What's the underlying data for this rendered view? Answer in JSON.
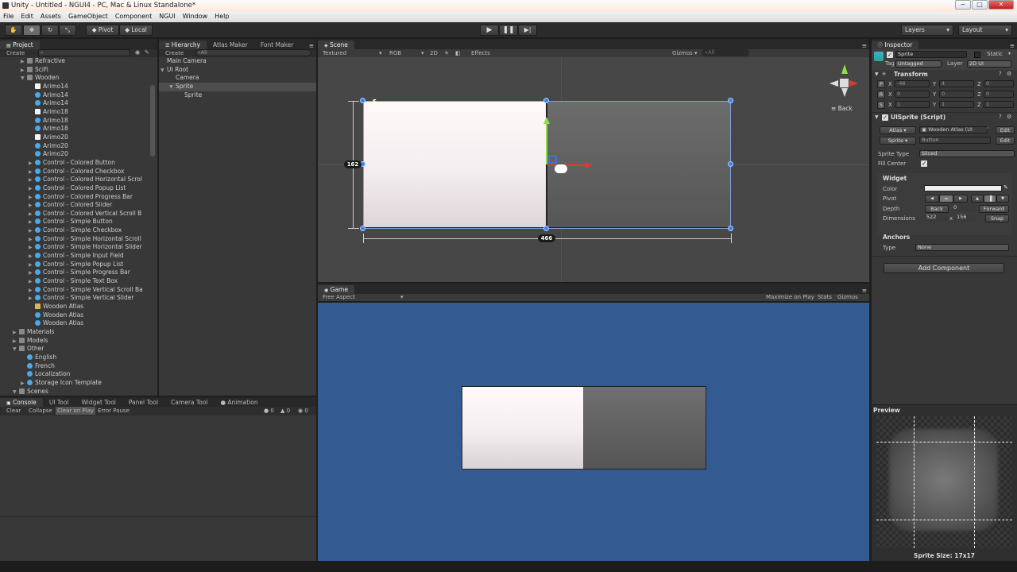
{
  "window": {
    "title": "Unity - Untitled - NGUI4 - PC, Mac & Linux Standalone*",
    "controls": [
      "−",
      "□",
      "✕"
    ]
  },
  "menu": [
    "File",
    "Edit",
    "Assets",
    "GameObject",
    "Component",
    "NGUI",
    "Window",
    "Help"
  ],
  "toolbar": {
    "pivot": "Pivot",
    "local": "Local",
    "layers": "Layers",
    "layout": "Layout"
  },
  "project": {
    "tab": "Project",
    "create": "Create",
    "search_placeholder": "",
    "items": [
      {
        "label": "Refractive",
        "indent": 2,
        "icon": "gfolder",
        "arrow": "▶"
      },
      {
        "label": "SciFi",
        "indent": 2,
        "icon": "gfolder",
        "arrow": "▶"
      },
      {
        "label": "Wooden",
        "indent": 2,
        "icon": "gfolder",
        "arrow": "▼"
      },
      {
        "label": "Arimo14",
        "indent": 3,
        "icon": "white"
      },
      {
        "label": "Arimo14",
        "indent": 3,
        "icon": "pf"
      },
      {
        "label": "Arimo14",
        "indent": 3,
        "icon": "pf"
      },
      {
        "label": "Arimo18",
        "indent": 3,
        "icon": "white"
      },
      {
        "label": "Arimo18",
        "indent": 3,
        "icon": "pf"
      },
      {
        "label": "Arimo18",
        "indent": 3,
        "icon": "pf"
      },
      {
        "label": "Arimo20",
        "indent": 3,
        "icon": "white"
      },
      {
        "label": "Arimo20",
        "indent": 3,
        "icon": "pf"
      },
      {
        "label": "Arimo20",
        "indent": 3,
        "icon": "pf"
      },
      {
        "label": "Control - Colored Button",
        "indent": 3,
        "icon": "pf",
        "arrow": "▶"
      },
      {
        "label": "Control - Colored Checkbox",
        "indent": 3,
        "icon": "pf",
        "arrow": "▶"
      },
      {
        "label": "Control - Colored Horizontal Scrol",
        "indent": 3,
        "icon": "pf",
        "arrow": "▶"
      },
      {
        "label": "Control - Colored Popup List",
        "indent": 3,
        "icon": "pf",
        "arrow": "▶"
      },
      {
        "label": "Control - Colored Progress Bar",
        "indent": 3,
        "icon": "pf",
        "arrow": "▶"
      },
      {
        "label": "Control - Colored Slider",
        "indent": 3,
        "icon": "pf",
        "arrow": "▶"
      },
      {
        "label": "Control - Colored Vertical Scroll B",
        "indent": 3,
        "icon": "pf",
        "arrow": "▶"
      },
      {
        "label": "Control - Simple Button",
        "indent": 3,
        "icon": "pf",
        "arrow": "▶"
      },
      {
        "label": "Control - Simple Checkbox",
        "indent": 3,
        "icon": "pf",
        "arrow": "▶"
      },
      {
        "label": "Control - Simple Horizontal Scroll",
        "indent": 3,
        "icon": "pf",
        "arrow": "▶"
      },
      {
        "label": "Control - Simple Horizontal Slider",
        "indent": 3,
        "icon": "pf",
        "arrow": "▶"
      },
      {
        "label": "Control - Simple Input Field",
        "indent": 3,
        "icon": "pf",
        "arrow": "▶"
      },
      {
        "label": "Control - Simple Popup List",
        "indent": 3,
        "icon": "pf",
        "arrow": "▶"
      },
      {
        "label": "Control - Simple Progress Bar",
        "indent": 3,
        "icon": "pf",
        "arrow": "▶"
      },
      {
        "label": "Control - Simple Text Box",
        "indent": 3,
        "icon": "pf",
        "arrow": "▶"
      },
      {
        "label": "Control - Simple Vertical Scroll Ba",
        "indent": 3,
        "icon": "pf",
        "arrow": "▶"
      },
      {
        "label": "Control - Simple Vertical Slider",
        "indent": 3,
        "icon": "pf",
        "arrow": "▶"
      },
      {
        "label": "Wooden Atlas",
        "indent": 3,
        "icon": "atlas"
      },
      {
        "label": "Wooden Atlas",
        "indent": 3,
        "icon": "pf"
      },
      {
        "label": "Wooden Atlas",
        "indent": 3,
        "icon": "pf"
      },
      {
        "label": "Materials",
        "indent": 1,
        "icon": "gfolder",
        "arrow": "▶"
      },
      {
        "label": "Models",
        "indent": 1,
        "icon": "gfolder",
        "arrow": "▶"
      },
      {
        "label": "Other",
        "indent": 1,
        "icon": "gfolder",
        "arrow": "▼"
      },
      {
        "label": "English",
        "indent": 2,
        "icon": "pf"
      },
      {
        "label": "French",
        "indent": 2,
        "icon": "pf"
      },
      {
        "label": "Localization",
        "indent": 2,
        "icon": "pf"
      },
      {
        "label": "Storage Icon Template",
        "indent": 2,
        "icon": "pf",
        "arrow": "▶"
      },
      {
        "label": "Scenes",
        "indent": 1,
        "icon": "gfolder",
        "arrow": "▼"
      }
    ]
  },
  "hierarchy": {
    "tabs": [
      "Hierarchy",
      "Atlas Maker",
      "Font Maker"
    ],
    "create": "Create",
    "search_placeholder": "⌕All",
    "items": [
      {
        "label": "Main Camera",
        "indent": 0
      },
      {
        "label": "UI Root",
        "indent": 0,
        "arrow": "▼"
      },
      {
        "label": "Camera",
        "indent": 1
      },
      {
        "label": "Sprite",
        "indent": 1,
        "arrow": "▼",
        "selected": true
      },
      {
        "label": "Sprite",
        "indent": 2
      }
    ]
  },
  "bottom_tabs": {
    "tabs": [
      "Console",
      "UI Tool",
      "Widget Tool",
      "Panel Tool",
      "Camera Tool",
      "Animation"
    ],
    "actions": [
      "Clear",
      "Collapse",
      "Clear on Play",
      "Error Pause"
    ],
    "counts": [
      "0",
      "0",
      "0"
    ]
  },
  "scene": {
    "tab": "Scene",
    "mode": "Textured",
    "channel": "RGB",
    "view2d": "2D",
    "effects": "Effects",
    "gizmos": "Gizmos",
    "search_placeholder": "⌕All",
    "height_label": "162",
    "width_label": "466",
    "gizmo_label": "Back"
  },
  "game": {
    "tab": "Game",
    "aspect": "Free Aspect",
    "maximize": "Maximize on Play",
    "stats": "Stats",
    "gizmos": "Gizmos",
    "bg_color": "#345a92"
  },
  "inspector": {
    "tab": "Inspector",
    "object_name": "Sprite",
    "static_label": "Static",
    "tag_label": "Tag",
    "tag_value": "Untagged",
    "layer_label": "Layer",
    "layer_value": "2D UI",
    "transform": {
      "title": "Transform",
      "rows": [
        {
          "letter": "P",
          "x": "-46",
          "y": "4",
          "z": "0"
        },
        {
          "letter": "R",
          "x": "0",
          "y": "0",
          "z": "0"
        },
        {
          "letter": "S",
          "x": "1",
          "y": "1",
          "z": "1"
        }
      ]
    },
    "uisprite": {
      "title": "UISprite (Script)",
      "atlas_label": "Atlas",
      "atlas_value": "Wooden Atlas (UI",
      "edit": "Edit",
      "sprite_label": "Sprite",
      "sprite_value": "Button",
      "sprite_type_label": "Sprite Type",
      "sprite_type_value": "Sliced",
      "fill_center_label": "Fill Center"
    },
    "widget": {
      "title": "Widget",
      "color_label": "Color",
      "pivot_label": "Pivot",
      "depth_label": "Depth",
      "back": "Back",
      "depth_value": "0",
      "forward": "Forward",
      "dimensions_label": "Dimensions",
      "width": "522",
      "x": "x",
      "height": "156",
      "snap": "Snap"
    },
    "anchors": {
      "title": "Anchors",
      "type_label": "Type",
      "type_value": "None"
    },
    "add_component": "Add Component",
    "preview_label": "Preview",
    "sprite_size": "Sprite Size: 17x17"
  }
}
